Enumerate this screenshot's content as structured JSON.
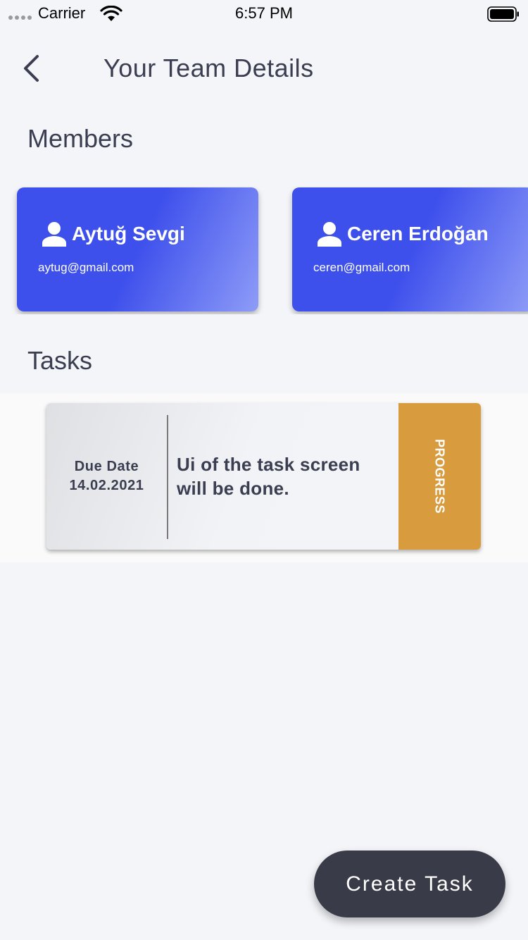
{
  "status_bar": {
    "carrier": "Carrier",
    "time": "6:57 PM"
  },
  "header": {
    "title": "Your Team Details",
    "back_icon": "chevron-left-icon"
  },
  "members": {
    "title": "Members",
    "items": [
      {
        "name": "Aytuğ Sevgi",
        "email": "aytug@gmail.com",
        "icon": "person-icon"
      },
      {
        "name": "Ceren Erdoğan",
        "email": "ceren@gmail.com",
        "icon": "person-icon"
      }
    ]
  },
  "tasks": {
    "title": "Tasks",
    "items": [
      {
        "due_label": "Due Date",
        "due_date": "14.02.2021",
        "description": "Ui of the task screen will be done.",
        "status": "PROGRESS"
      }
    ]
  },
  "fab": {
    "label": "Create Task"
  },
  "colors": {
    "card_blue": "#3e50ec",
    "status_progress": "#d89b3d",
    "fab_bg": "#393c48",
    "text": "#3a3e50"
  }
}
